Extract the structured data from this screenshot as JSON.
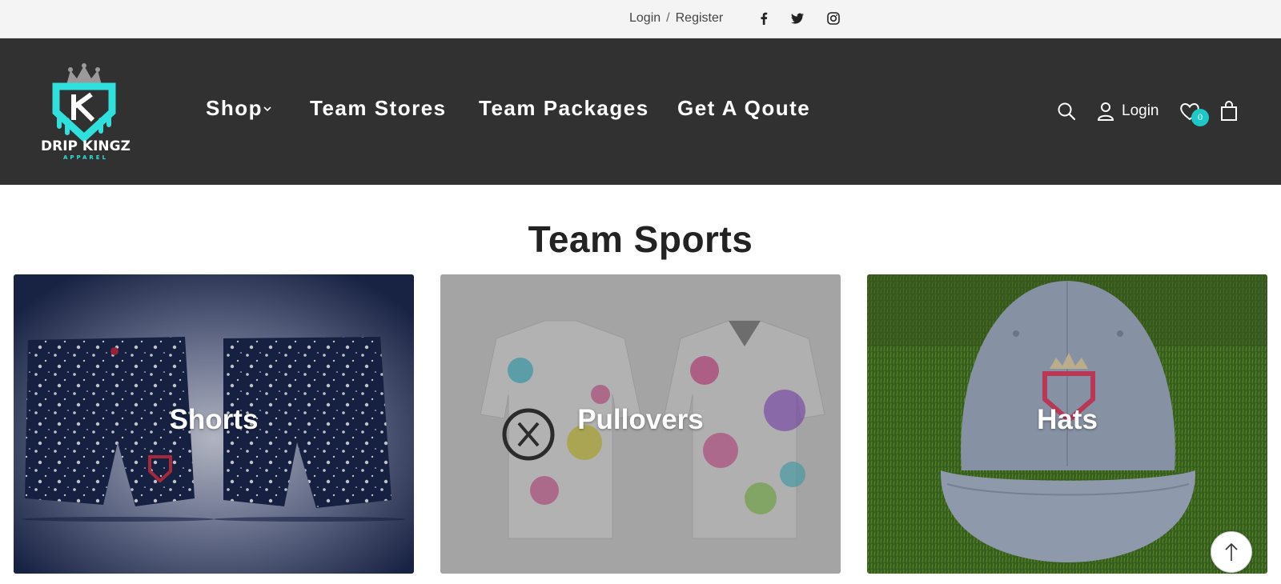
{
  "topbar": {
    "login": "Login",
    "separator": "/",
    "register": "Register",
    "social": [
      "facebook-icon",
      "twitter-icon",
      "instagram-icon"
    ]
  },
  "header": {
    "logo": {
      "line1": "DRIP KINGZ",
      "line2": "APPAREL"
    },
    "nav": [
      {
        "label": "Shop",
        "has_dropdown": true
      },
      {
        "label": "Team Stores"
      },
      {
        "label": "Team Packages"
      },
      {
        "label": "Get A Qoute"
      }
    ],
    "login_label": "Login",
    "wishlist_count": "0",
    "colors": {
      "header_bg": "#313131",
      "accent": "#1ec8c8"
    }
  },
  "section": {
    "title": "Team Sports",
    "cards": [
      {
        "title": "Shorts"
      },
      {
        "title": "Pullovers"
      },
      {
        "title": "Hats"
      }
    ]
  }
}
